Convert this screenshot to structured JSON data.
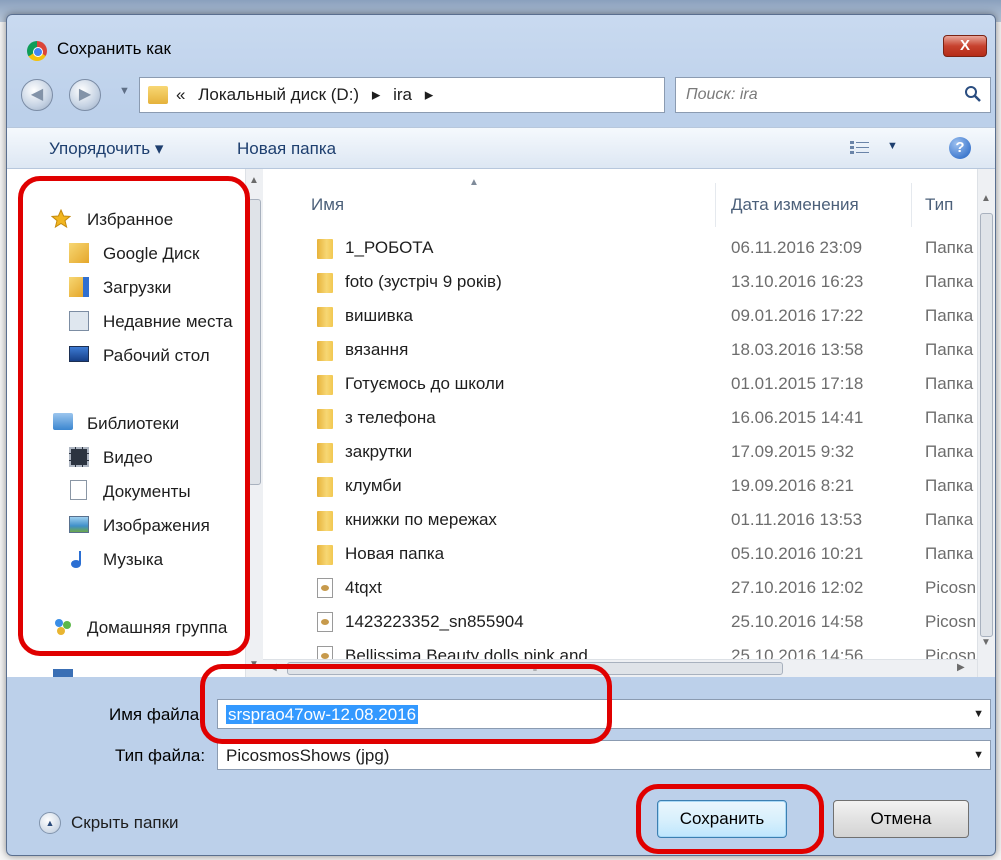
{
  "window": {
    "title": "Сохранить как",
    "close_label": "X"
  },
  "address": {
    "crumbs": [
      "«",
      "Локальный диск (D:)",
      "▸",
      "ira",
      "▸"
    ],
    "search_placeholder": "Поиск: ira"
  },
  "toolbar": {
    "organize": "Упорядочить ▾",
    "new_folder": "Новая папка"
  },
  "nav": {
    "favorites": "Избранное",
    "favorites_items": [
      "Google Диск",
      "Загрузки",
      "Недавние места",
      "Рабочий стол"
    ],
    "libraries": "Библиотеки",
    "library_items": [
      "Видео",
      "Документы",
      "Изображения",
      "Музыка"
    ],
    "homegroup": "Домашняя группа"
  },
  "columns": {
    "name": "Имя",
    "date": "Дата изменения",
    "type": "Тип"
  },
  "files": [
    {
      "name": "1_РОБОТА",
      "date": "06.11.2016 23:09",
      "type": "Папка",
      "kind": "folder"
    },
    {
      "name": "foto (зустріч 9 років)",
      "date": "13.10.2016 16:23",
      "type": "Папка",
      "kind": "folder"
    },
    {
      "name": "вишивка",
      "date": "09.01.2016 17:22",
      "type": "Папка",
      "kind": "folder"
    },
    {
      "name": "вязання",
      "date": "18.03.2016 13:58",
      "type": "Папка",
      "kind": "folder"
    },
    {
      "name": "Готуємось до школи",
      "date": "01.01.2015 17:18",
      "type": "Папка",
      "kind": "folder"
    },
    {
      "name": "з телефона",
      "date": "16.06.2015 14:41",
      "type": "Папка",
      "kind": "folder"
    },
    {
      "name": "закрутки",
      "date": "17.09.2015 9:32",
      "type": "Папка",
      "kind": "folder"
    },
    {
      "name": "клумби",
      "date": "19.09.2016 8:21",
      "type": "Папка",
      "kind": "folder"
    },
    {
      "name": "книжки по мережах",
      "date": "01.11.2016 13:53",
      "type": "Папка",
      "kind": "folder"
    },
    {
      "name": "Новая папка",
      "date": "05.10.2016 10:21",
      "type": "Папка",
      "kind": "folder"
    },
    {
      "name": "4tqxt",
      "date": "27.10.2016 12:02",
      "type": "Picosn",
      "kind": "image"
    },
    {
      "name": "1423223352_sn855904",
      "date": "25.10.2016 14:58",
      "type": "Picosn",
      "kind": "image"
    },
    {
      "name": "Bellissima Beauty dolls pink and",
      "date": "25.10.2016 14:56",
      "type": "Picosn",
      "kind": "image"
    }
  ],
  "form": {
    "filename_label": "Имя файла:",
    "filename_value": "srsprao47ow-12.08.2016",
    "filetype_label": "Тип файла:",
    "filetype_value": "PicosmosShows (jpg)"
  },
  "hide_folders": "Скрыть папки",
  "buttons": {
    "save": "Сохранить",
    "cancel": "Отмена"
  },
  "colors": {
    "annotation": "#e00000",
    "selection": "#3399ff"
  }
}
